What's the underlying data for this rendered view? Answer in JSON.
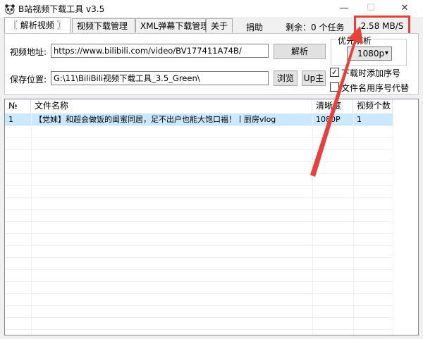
{
  "window": {
    "title": "B站视频下载工具 v3.5",
    "minimize": "—",
    "maximize": "☐",
    "close": "✕"
  },
  "tabs": [
    {
      "label": "〖 解析视频 〗"
    },
    {
      "label": "视频下载管理"
    },
    {
      "label": "XML弹幕下载管理"
    },
    {
      "label": "关于"
    }
  ],
  "header": {
    "donate": "捐助",
    "remaining": "剩余：0 个任务",
    "speed": "2.58 MB/S"
  },
  "form": {
    "url_label": "视频地址:",
    "url_value": "https://www.bilibili.com/video/BV177411A74B/",
    "parse_button": "解析",
    "path_label": "保存位置:",
    "path_value": "G:\\11\\BiliBili视频下载工具_3.5_Green\\",
    "browse_button": "浏览",
    "up_button": "Up主"
  },
  "options": {
    "group_title": "优先解析",
    "quality_value": "1080p",
    "add_index_label": "下载时添加序号",
    "add_index_checked": true,
    "rename_label": "文件名用序号代替",
    "rename_checked": false
  },
  "list": {
    "columns": [
      "№",
      "文件名称",
      "清晰度",
      "视频个数"
    ],
    "rows": [
      {
        "no": "1",
        "name": "【党妹】和超会做饭的闺蜜同居，足不出户也能大饱口福！丨厨房vlog",
        "quality": "1080P",
        "count": "1"
      }
    ]
  },
  "colors": {
    "highlight": "#e8413c",
    "selected_row": "#cce8ff"
  }
}
